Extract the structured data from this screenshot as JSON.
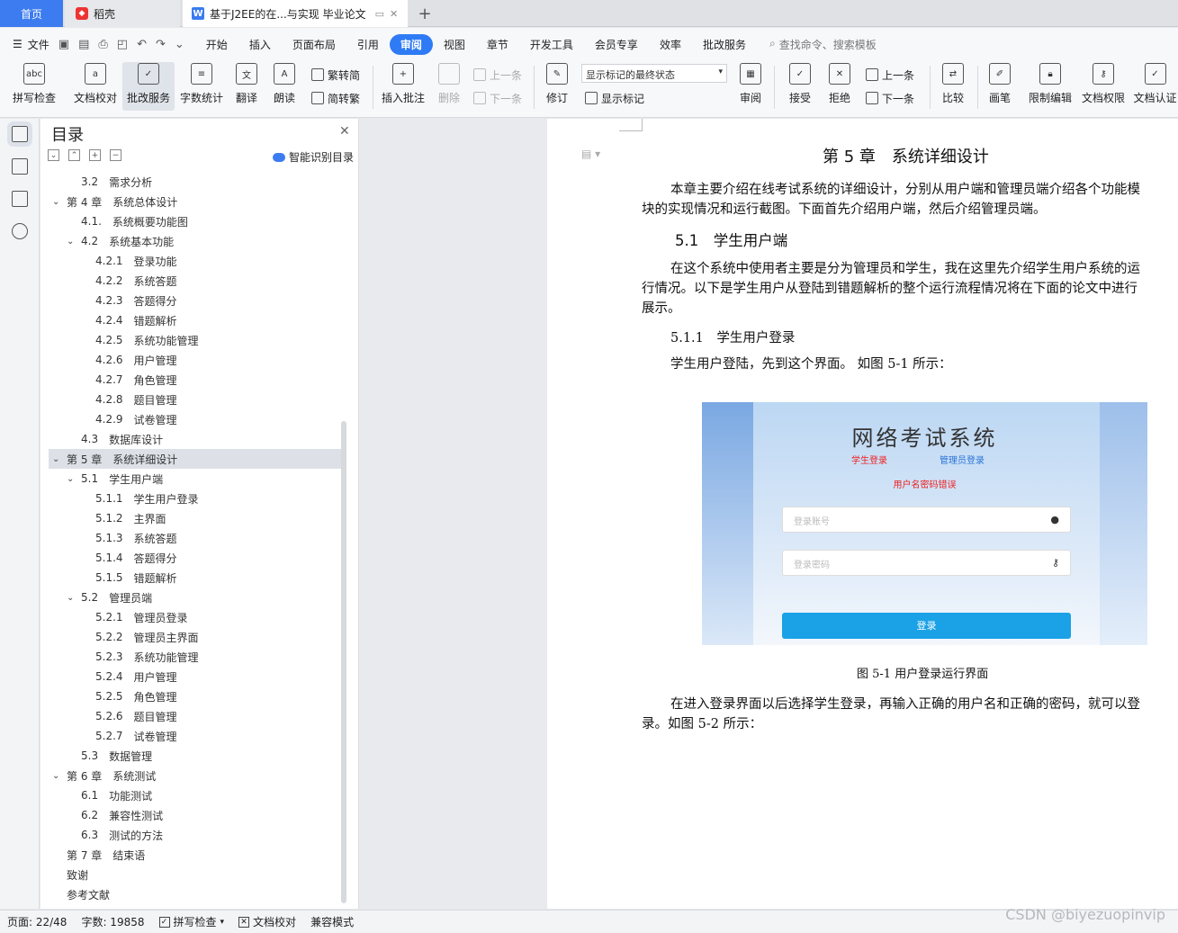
{
  "tabs": {
    "home": "首页",
    "daoke": "稻壳",
    "doc": "基于J2EE的在...与实现 毕业论文",
    "add": "+"
  },
  "menu": {
    "file": "文件",
    "items": [
      "开始",
      "插入",
      "页面布局",
      "引用",
      "审阅",
      "视图",
      "章节",
      "开发工具",
      "会员专享",
      "效率",
      "批改服务"
    ],
    "active": "审阅",
    "search": "查找命令、搜索模板"
  },
  "ribbon": {
    "spell_check": "拼写检查",
    "doc_proof": "文档校对",
    "review_service": "批改服务",
    "word_count": "字数统计",
    "translate": "翻译",
    "read_aloud": "朗读",
    "trad_to_simp": "繁转简",
    "simp_to_trad": "简转繁",
    "insert_comment": "插入批注",
    "delete": "删除",
    "prev": "上一条",
    "next": "下一条",
    "revise": "修订",
    "markup_state": "显示标记的最终状态",
    "show_markup": "显示标记",
    "review": "审阅",
    "accept": "接受",
    "reject": "拒绝",
    "prev2": "上一条",
    "next2": "下一条",
    "compare": "比较",
    "pen": "画笔",
    "restrict_edit": "限制编辑",
    "doc_permission": "文档权限",
    "doc_auth": "文档认证"
  },
  "toc": {
    "title": "目录",
    "smart": "智能识别目录",
    "items": [
      {
        "num": "3.2",
        "text": "需求分析",
        "level": 2,
        "arrow": ""
      },
      {
        "num": "第 4 章",
        "text": "系统总体设计",
        "level": 1,
        "arrow": "v"
      },
      {
        "num": "4.1.",
        "text": "系统概要功能图",
        "level": 2,
        "arrow": ""
      },
      {
        "num": "4.2",
        "text": "系统基本功能",
        "level": 2,
        "arrow": "v"
      },
      {
        "num": "4.2.1",
        "text": "登录功能",
        "level": 3,
        "arrow": ""
      },
      {
        "num": "4.2.2",
        "text": "系统答题",
        "level": 3,
        "arrow": ""
      },
      {
        "num": "4.2.3",
        "text": "答题得分",
        "level": 3,
        "arrow": ""
      },
      {
        "num": "4.2.4",
        "text": "错题解析",
        "level": 3,
        "arrow": ""
      },
      {
        "num": "4.2.5",
        "text": "系统功能管理",
        "level": 3,
        "arrow": ""
      },
      {
        "num": "4.2.6",
        "text": "用户管理",
        "level": 3,
        "arrow": ""
      },
      {
        "num": "4.2.7",
        "text": "角色管理",
        "level": 3,
        "arrow": ""
      },
      {
        "num": "4.2.8",
        "text": "题目管理",
        "level": 3,
        "arrow": ""
      },
      {
        "num": "4.2.9",
        "text": "试卷管理",
        "level": 3,
        "arrow": ""
      },
      {
        "num": "4.3",
        "text": "数据库设计",
        "level": 2,
        "arrow": ""
      },
      {
        "num": "第 5 章",
        "text": "系统详细设计",
        "level": 1,
        "arrow": "v",
        "selected": true
      },
      {
        "num": "5.1",
        "text": "学生用户端",
        "level": 2,
        "arrow": "v"
      },
      {
        "num": "5.1.1",
        "text": "学生用户登录",
        "level": 3,
        "arrow": ""
      },
      {
        "num": "5.1.2",
        "text": "主界面",
        "level": 3,
        "arrow": ""
      },
      {
        "num": "5.1.3",
        "text": "系统答题",
        "level": 3,
        "arrow": ""
      },
      {
        "num": "5.1.4",
        "text": "答题得分",
        "level": 3,
        "arrow": ""
      },
      {
        "num": "5.1.5",
        "text": "错题解析",
        "level": 3,
        "arrow": ""
      },
      {
        "num": "5.2",
        "text": "管理员端",
        "level": 2,
        "arrow": "v"
      },
      {
        "num": "5.2.1",
        "text": "管理员登录",
        "level": 3,
        "arrow": ""
      },
      {
        "num": "5.2.2",
        "text": "管理员主界面",
        "level": 3,
        "arrow": ""
      },
      {
        "num": "5.2.3",
        "text": "系统功能管理",
        "level": 3,
        "arrow": ""
      },
      {
        "num": "5.2.4",
        "text": "用户管理",
        "level": 3,
        "arrow": ""
      },
      {
        "num": "5.2.5",
        "text": "角色管理",
        "level": 3,
        "arrow": ""
      },
      {
        "num": "5.2.6",
        "text": "题目管理",
        "level": 3,
        "arrow": ""
      },
      {
        "num": "5.2.7",
        "text": "试卷管理",
        "level": 3,
        "arrow": ""
      },
      {
        "num": "5.3",
        "text": "数据管理",
        "level": 2,
        "arrow": ""
      },
      {
        "num": "第 6 章",
        "text": "系统测试",
        "level": 1,
        "arrow": "v"
      },
      {
        "num": "6.1",
        "text": "功能测试",
        "level": 2,
        "arrow": ""
      },
      {
        "num": "6.2",
        "text": "兼容性测试",
        "level": 2,
        "arrow": ""
      },
      {
        "num": "6.3",
        "text": "测试的方法",
        "level": 2,
        "arrow": ""
      },
      {
        "num": "第 7 章",
        "text": "结束语",
        "level": 1,
        "arrow": ""
      },
      {
        "num": "致谢",
        "text": "",
        "level": 1,
        "arrow": ""
      },
      {
        "num": "参考文献",
        "text": "",
        "level": 1,
        "arrow": ""
      }
    ]
  },
  "doc": {
    "chapter_title": "第 5 章　系统详细设计",
    "intro_line1": "本章主要介绍在线考试系统的详细设计，分别从用户端和管理员端介绍各个功能模",
    "intro_line2": "块的实现情况和运行截图。下面首先介绍用户端，然后介绍管理员端。",
    "section_title": "5.1　学生用户端",
    "sec_line1": "在这个系统中使用者主要是分为管理员和学生，我在这里先介绍学生用户系统的运",
    "sec_line2": "行情况。以下是学生用户从登陆到错题解析的整个运行流程情况将在下面的论文中进行",
    "sec_line3": "展示。",
    "subsection_title": "5.1.1　学生用户登录",
    "sub_line": "学生用户登陆，先到这个界面。 如图 5-1 所示：",
    "caption": "图 5-1 用户登录运行界面",
    "after_line1": "在进入登录界面以后选择学生登录，再输入正确的用户名和正确的密码，就可以登",
    "after_line2": "录。如图 5-2 所示："
  },
  "figure": {
    "title": "网络考试系统",
    "tab_student": "学生登录",
    "tab_admin": "管理员登录",
    "error": "用户名密码错误",
    "account_placeholder": "登录账号",
    "password_placeholder": "登录密码",
    "login_button": "登录"
  },
  "status": {
    "page": "页面: 22/48",
    "words": "字数: 19858",
    "spell": "拼写检查",
    "proof": "文档校对",
    "compat": "兼容模式"
  },
  "watermark": "CSDN @biyezuopinvip",
  "colors": {
    "accent": "#2f7bf5",
    "home_tab": "#3c7cf0",
    "login_button": "#1aa1e6",
    "error_red": "#e22"
  }
}
